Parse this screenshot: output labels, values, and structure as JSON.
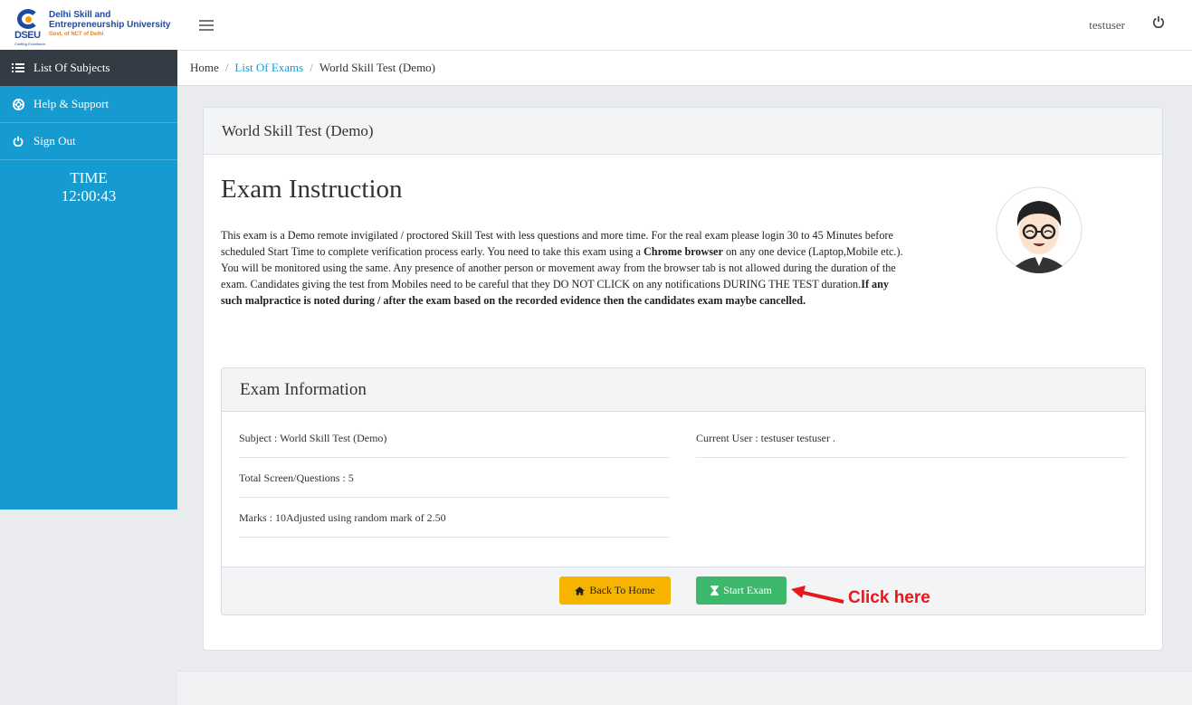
{
  "brand": {
    "name_line1": "Delhi Skill and",
    "name_line2": "Entrepreneurship University",
    "name_line3": "Govt. of NCT of Delhi",
    "logo_abbrev": "DSEU",
    "logo_tagline": "Crafting Excellence"
  },
  "header": {
    "username": "testuser"
  },
  "sidebar": {
    "items": [
      {
        "label": "List Of Subjects",
        "icon": "list-icon"
      },
      {
        "label": "Help & Support",
        "icon": "lifebuoy-icon"
      },
      {
        "label": "Sign Out",
        "icon": "power-icon"
      }
    ],
    "time_label": "TIME",
    "time_value": "12:00:43"
  },
  "breadcrumb": {
    "home": "Home",
    "exams": "List Of Exams",
    "current": "World Skill Test (Demo)"
  },
  "card": {
    "title": "World Skill Test (Demo)",
    "instruction_heading": "Exam Instruction",
    "instruction_text_normal": "This exam is a Demo remote invigilated / proctored Skill Test with less questions and more time. For the real exam please login 30 to 45 Minutes before scheduled Start Time to complete verification process early. You need to take this exam using a ",
    "instruction_text_bold1": "Chrome browser",
    "instruction_text_normal2": " on any one device (Laptop,Mobile etc.). You will be monitored using the same. Any presence of another person or movement away from the browser tab is not allowed during the duration of the exam. Candidates giving the test from Mobiles need to be careful that they DO NOT CLICK on any notifications DURING THE TEST duration.",
    "instruction_text_bold2": "If any such malpractice is noted during / after the exam based on the recorded evidence then the candidates exam maybe cancelled."
  },
  "info": {
    "heading": "Exam Information",
    "subject": "Subject : World Skill Test (Demo)",
    "total_questions": "Total Screen/Questions : 5",
    "marks": "Marks : 10Adjusted using random mark of 2.50",
    "current_user": "Current User : testuser testuser ."
  },
  "buttons": {
    "back_home": "Back To Home",
    "start_exam": "Start Exam"
  },
  "annotation": {
    "text": "Click here",
    "color": "#e3191b"
  },
  "colors": {
    "sidebar": "#169bd0",
    "sidebar_active": "#333c44",
    "link": "#169bd0",
    "warning": "#f6b400",
    "success": "#3db86b"
  }
}
